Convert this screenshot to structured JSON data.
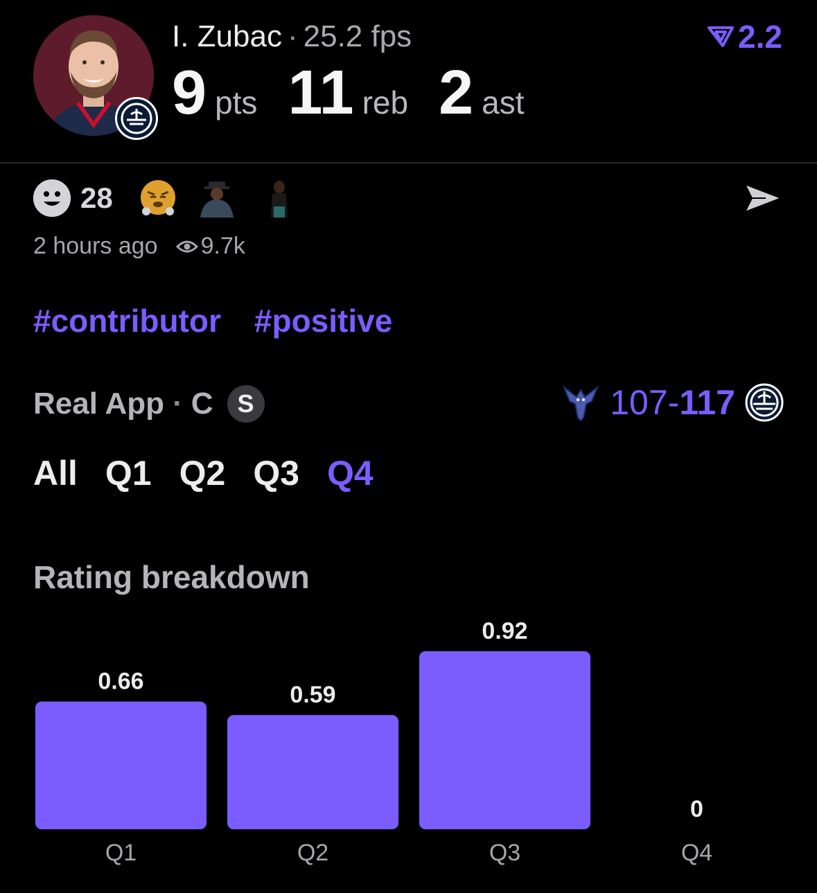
{
  "header": {
    "player_name": "I. Zubac",
    "separator": "·",
    "fps": "25.2 fps",
    "stats": [
      {
        "value": "9",
        "label": "pts"
      },
      {
        "value": "11",
        "label": "reb"
      },
      {
        "value": "2",
        "label": "ast"
      }
    ],
    "rating_value": "2.2",
    "avatar_icon": "player-avatar",
    "team_icon": "clippers-logo-icon"
  },
  "reactions": {
    "count": "28",
    "items": [
      "huffing-face-emoji",
      "person-sticker-1",
      "person-sticker-2"
    ]
  },
  "meta": {
    "time_ago": "2 hours ago",
    "views": "9.7k"
  },
  "tags": [
    "#contributor",
    "#positive"
  ],
  "source": {
    "app": "Real App",
    "separator": "·",
    "position": "C",
    "badge": "S"
  },
  "game": {
    "score_left": "107",
    "score_sep": "-",
    "score_right": "117",
    "left_team_icon": "hornets-logo-icon",
    "right_team_icon": "clippers-logo-icon"
  },
  "tabs": {
    "items": [
      "All",
      "Q1",
      "Q2",
      "Q3",
      "Q4"
    ],
    "active": "Q4"
  },
  "colors": {
    "accent": "#7b5cff",
    "background": "#000000"
  },
  "chart_data": {
    "type": "bar",
    "title": "Rating breakdown",
    "categories": [
      "Q1",
      "Q2",
      "Q3",
      "Q4"
    ],
    "values": [
      0.66,
      0.59,
      0.92,
      0
    ],
    "value_labels": [
      "0.66",
      "0.59",
      "0.92",
      "0"
    ],
    "ylim": [
      0,
      0.92
    ],
    "grid": false
  }
}
